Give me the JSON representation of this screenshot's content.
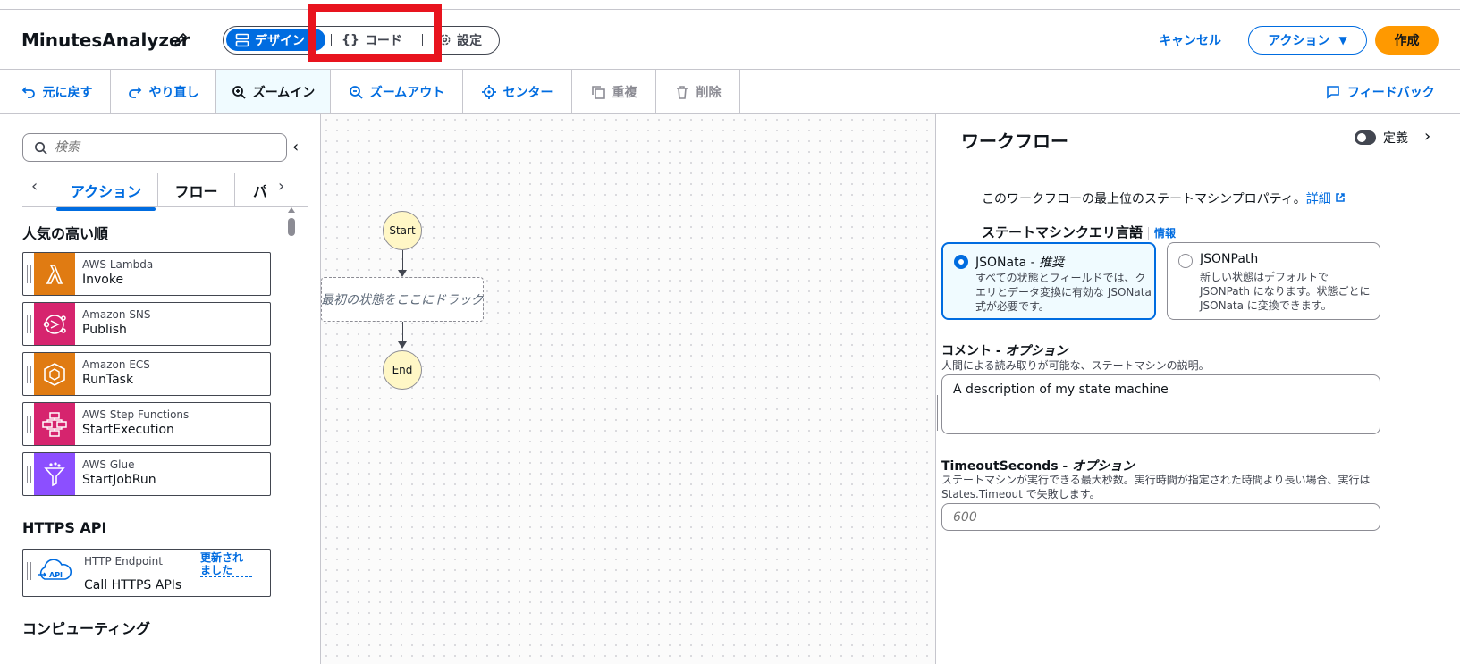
{
  "header": {
    "title": "MinutesAnalyzer",
    "mode_design": "デザイン",
    "mode_code": "コード",
    "mode_settings": "設定",
    "cancel": "キャンセル",
    "actions": "アクション",
    "create": "作成"
  },
  "toolbar": {
    "undo": "元に戻す",
    "redo": "やり直し",
    "zoom_in": "ズームイン",
    "zoom_out": "ズームアウト",
    "center": "センター",
    "duplicate": "重複",
    "delete": "削除",
    "feedback": "フィードバック"
  },
  "left_panel": {
    "search_placeholder": "検索",
    "tabs": [
      "アクション",
      "フロー",
      "パ"
    ],
    "popular_heading": "人気の高い順",
    "popular": [
      {
        "service": "AWS Lambda",
        "action": "Invoke",
        "color": "#e07b12"
      },
      {
        "service": "Amazon SNS",
        "action": "Publish",
        "color": "#d6246e"
      },
      {
        "service": "Amazon ECS",
        "action": "RunTask",
        "color": "#e07b12"
      },
      {
        "service": "AWS Step Functions",
        "action": "StartExecution",
        "color": "#d6246e"
      },
      {
        "service": "AWS Glue",
        "action": "StartJobRun",
        "color": "#8c4fff"
      }
    ],
    "https_heading": "HTTPS API",
    "http": {
      "service": "HTTP Endpoint",
      "action": "Call HTTPS APIs",
      "badge": "更新されました",
      "icon_text": "API"
    },
    "compute_heading": "コンピューティング"
  },
  "canvas": {
    "start": "Start",
    "dropzone": "最初の状態をここにドラッグ",
    "end": "End"
  },
  "right_panel": {
    "title": "ワークフロー",
    "toggle_label": "定義",
    "description": "このワークフローの最上位のステートマシンプロパティ。",
    "details_link": "詳細",
    "query_lang_label": "ステートマシンクエリ言語",
    "info": "情報",
    "jsonata_title": "JSONata - ",
    "jsonata_em": "推奨",
    "jsonata_desc": "すべての状態とフィールドでは、クエリとデータ変換に有効な JSONata 式が必要です。",
    "jsonpath_title": "JSONPath",
    "jsonpath_desc": "新しい状態はデフォルトで JSONPath になります。状態ごとに JSONata に変換できます。",
    "comment_label": "コメント - ",
    "comment_em": "オプション",
    "comment_desc": "人間による読み取りが可能な、ステートマシンの説明。",
    "comment_value": "A description of my state machine",
    "timeout_label": "TimeoutSeconds - ",
    "timeout_em": "オプション",
    "timeout_desc": "ステートマシンが実行できる最大秒数。実行時間が指定された時間より長い場合、実行は States.Timeout で失敗します。",
    "timeout_placeholder": "600"
  },
  "colors": {
    "accent": "#006ce0",
    "primary_button": "#ff9900",
    "highlight": "#e8141e"
  }
}
